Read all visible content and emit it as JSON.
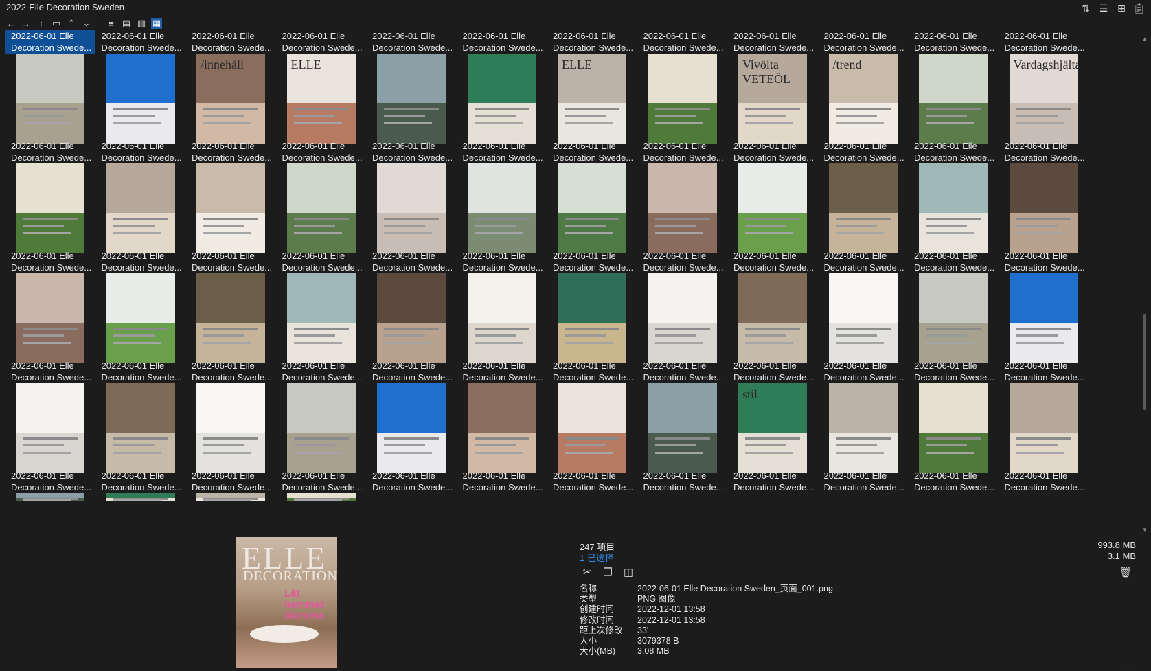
{
  "window": {
    "title": "2022-Elle Decoration Sweden"
  },
  "toolbar": {
    "buttons": [
      "back-icon",
      "forward-icon",
      "up-icon",
      "folder-icon",
      "collapse-icon",
      "expand-icon",
      "list-view-icon",
      "details-view-icon",
      "tiles-view-icon",
      "large-icons-view-icon"
    ]
  },
  "topbar_icons": [
    "sort-icon",
    "properties-icon",
    "new-window-icon",
    "clipboard-icon"
  ],
  "grid": {
    "item_label_line1": "2022-06-01 Elle",
    "item_label_line2": "Decoration Swede...",
    "columns": 12,
    "selected_index": 0
  },
  "thumb_texts": {
    "r1c2": "/innehåll",
    "r1c3": "ELLE",
    "r1c6": "ELLE",
    "r1c8": "Vivölta VETEÖL",
    "r1c9": "/trend",
    "r1c11": "Vardagshjältar",
    "r4c8": "stil"
  },
  "preview": {
    "brand": "ELLE",
    "sub": "DECORATION",
    "headline": "Låt hemmet blomma"
  },
  "status": {
    "item_count": "247 项目",
    "selected_count": "1 已选择",
    "total_size": "993.8 MB",
    "selected_size": "3.1 MB"
  },
  "properties": [
    {
      "key": "名称",
      "value": "2022-06-01 Elle Decoration Sweden_页面_001.png"
    },
    {
      "key": "类型",
      "value": "PNG 图像"
    },
    {
      "key": "创建时间",
      "value": "2022-12-01  13:58"
    },
    {
      "key": "修改时间",
      "value": "2022-12-01  13:58"
    },
    {
      "key": "距上次修改",
      "value": "33'"
    },
    {
      "key": "大小",
      "value": "3079378 B"
    },
    {
      "key": "大小(MB)",
      "value": "3.08 MB"
    }
  ],
  "colors": {
    "background": "#1c1c1c",
    "selection": "#0f4f95",
    "accent_blue": "#2f8be6"
  }
}
